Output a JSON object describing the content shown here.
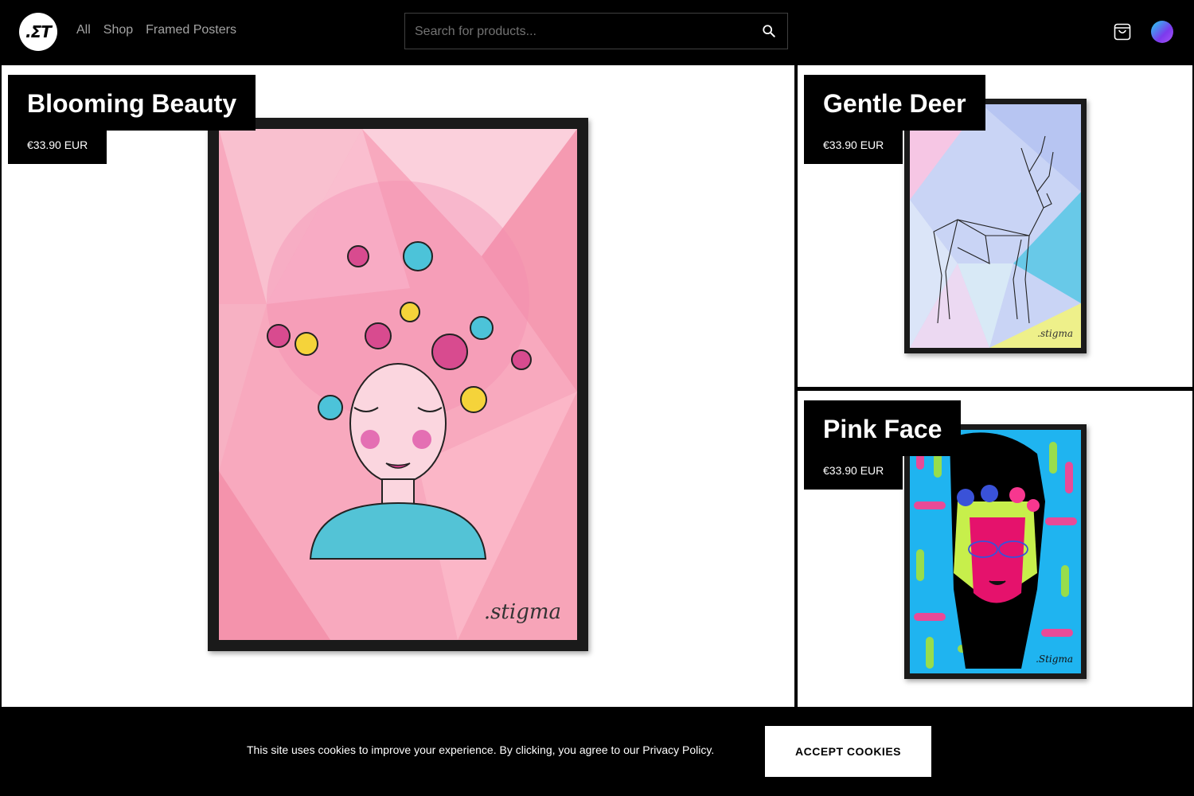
{
  "header": {
    "logo_text": ".ΣT",
    "nav": [
      "All",
      "Shop",
      "Framed Posters"
    ],
    "search": {
      "placeholder": "Search for products...",
      "icon": "search-icon"
    },
    "cart_icon": "shopping-bag-icon",
    "avatar_colors": [
      "#22d3ee",
      "#7c3aed"
    ]
  },
  "products": [
    {
      "title": "Blooming Beauty",
      "price": "€33.90 EUR",
      "signature": ".stigma",
      "bg": "#f8a9be"
    },
    {
      "title": "Gentle Deer",
      "price": "€33.90 EUR",
      "signature": ".stigma",
      "bg": "#c9d4f5"
    },
    {
      "title": "Pink Face",
      "price": "€33.90 EUR",
      "signature": ".Stigma",
      "bg": "#1fb4f0"
    }
  ],
  "cookie": {
    "message": "This site uses cookies to improve your experience. By clicking, you agree to our Privacy Policy.",
    "button": "ACCEPT COOKIES"
  }
}
